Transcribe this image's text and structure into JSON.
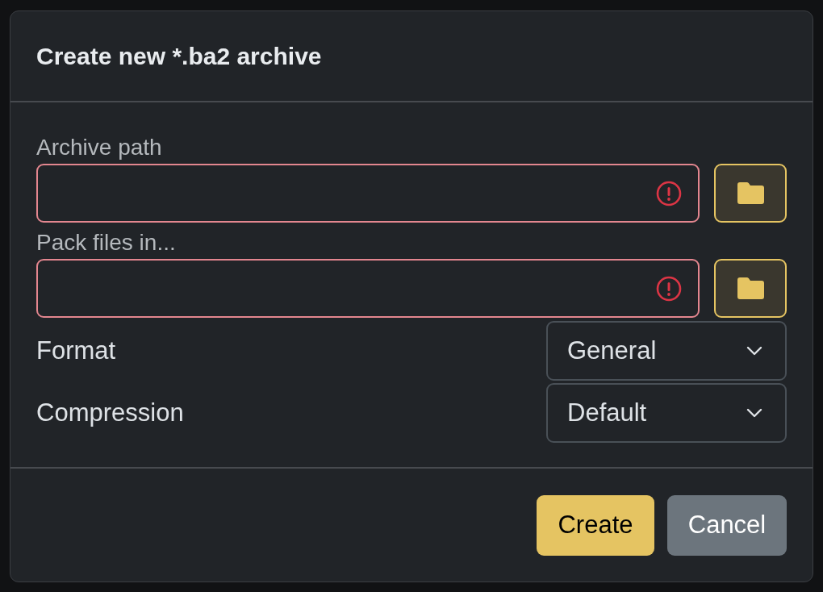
{
  "dialog": {
    "title": "Create new *.ba2 archive"
  },
  "fields": [
    {
      "label": "Archive path",
      "invalid": true
    },
    {
      "label": "Pack files in...",
      "invalid": true
    }
  ],
  "selects": [
    {
      "label": "Format",
      "value": "General"
    },
    {
      "label": "Compression",
      "value": "Default"
    }
  ],
  "buttons": [
    {
      "label": "Create",
      "kind": "primary"
    },
    {
      "label": "Cancel",
      "kind": "secondary"
    }
  ]
}
